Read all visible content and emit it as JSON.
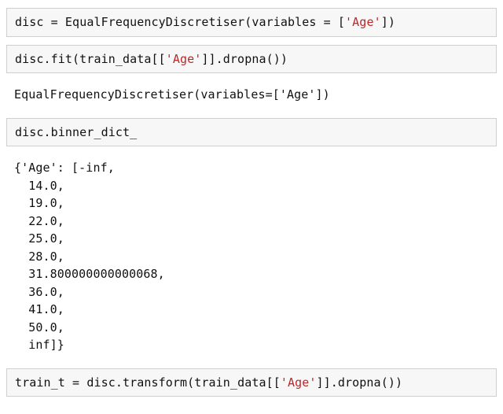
{
  "cells": [
    {
      "kind": "code",
      "tokens": [
        {
          "t": "disc ",
          "cls": "tok-plain"
        },
        {
          "t": "=",
          "cls": "tok-plain"
        },
        {
          "t": " EqualFrequencyDiscretiser(variables ",
          "cls": "tok-plain"
        },
        {
          "t": "=",
          "cls": "tok-plain"
        },
        {
          "t": " [",
          "cls": "tok-plain"
        },
        {
          "t": "'Age'",
          "cls": "tok-str"
        },
        {
          "t": "])",
          "cls": "tok-plain"
        }
      ]
    },
    {
      "kind": "code",
      "tokens": [
        {
          "t": "disc.fit(train_data[[",
          "cls": "tok-plain"
        },
        {
          "t": "'Age'",
          "cls": "tok-str"
        },
        {
          "t": "]].dropna())",
          "cls": "tok-plain"
        }
      ]
    },
    {
      "kind": "output",
      "tokens": [
        {
          "t": "EqualFrequencyDiscretiser(variables=['Age'])",
          "cls": "tok-plain"
        }
      ]
    },
    {
      "kind": "code",
      "tokens": [
        {
          "t": "disc.binner_dict_",
          "cls": "tok-plain"
        }
      ]
    },
    {
      "kind": "output",
      "tokens": [
        {
          "t": "{'Age': [-inf,\n  14.0,\n  19.0,\n  22.0,\n  25.0,\n  28.0,\n  31.800000000000068,\n  36.0,\n  41.0,\n  50.0,\n  inf]}",
          "cls": "tok-plain"
        }
      ]
    },
    {
      "kind": "code",
      "tokens": [
        {
          "t": "train_t ",
          "cls": "tok-plain"
        },
        {
          "t": "=",
          "cls": "tok-plain"
        },
        {
          "t": " disc.transform(train_data[[",
          "cls": "tok-plain"
        },
        {
          "t": "'Age'",
          "cls": "tok-str"
        },
        {
          "t": "]].dropna())",
          "cls": "tok-plain"
        }
      ]
    }
  ]
}
